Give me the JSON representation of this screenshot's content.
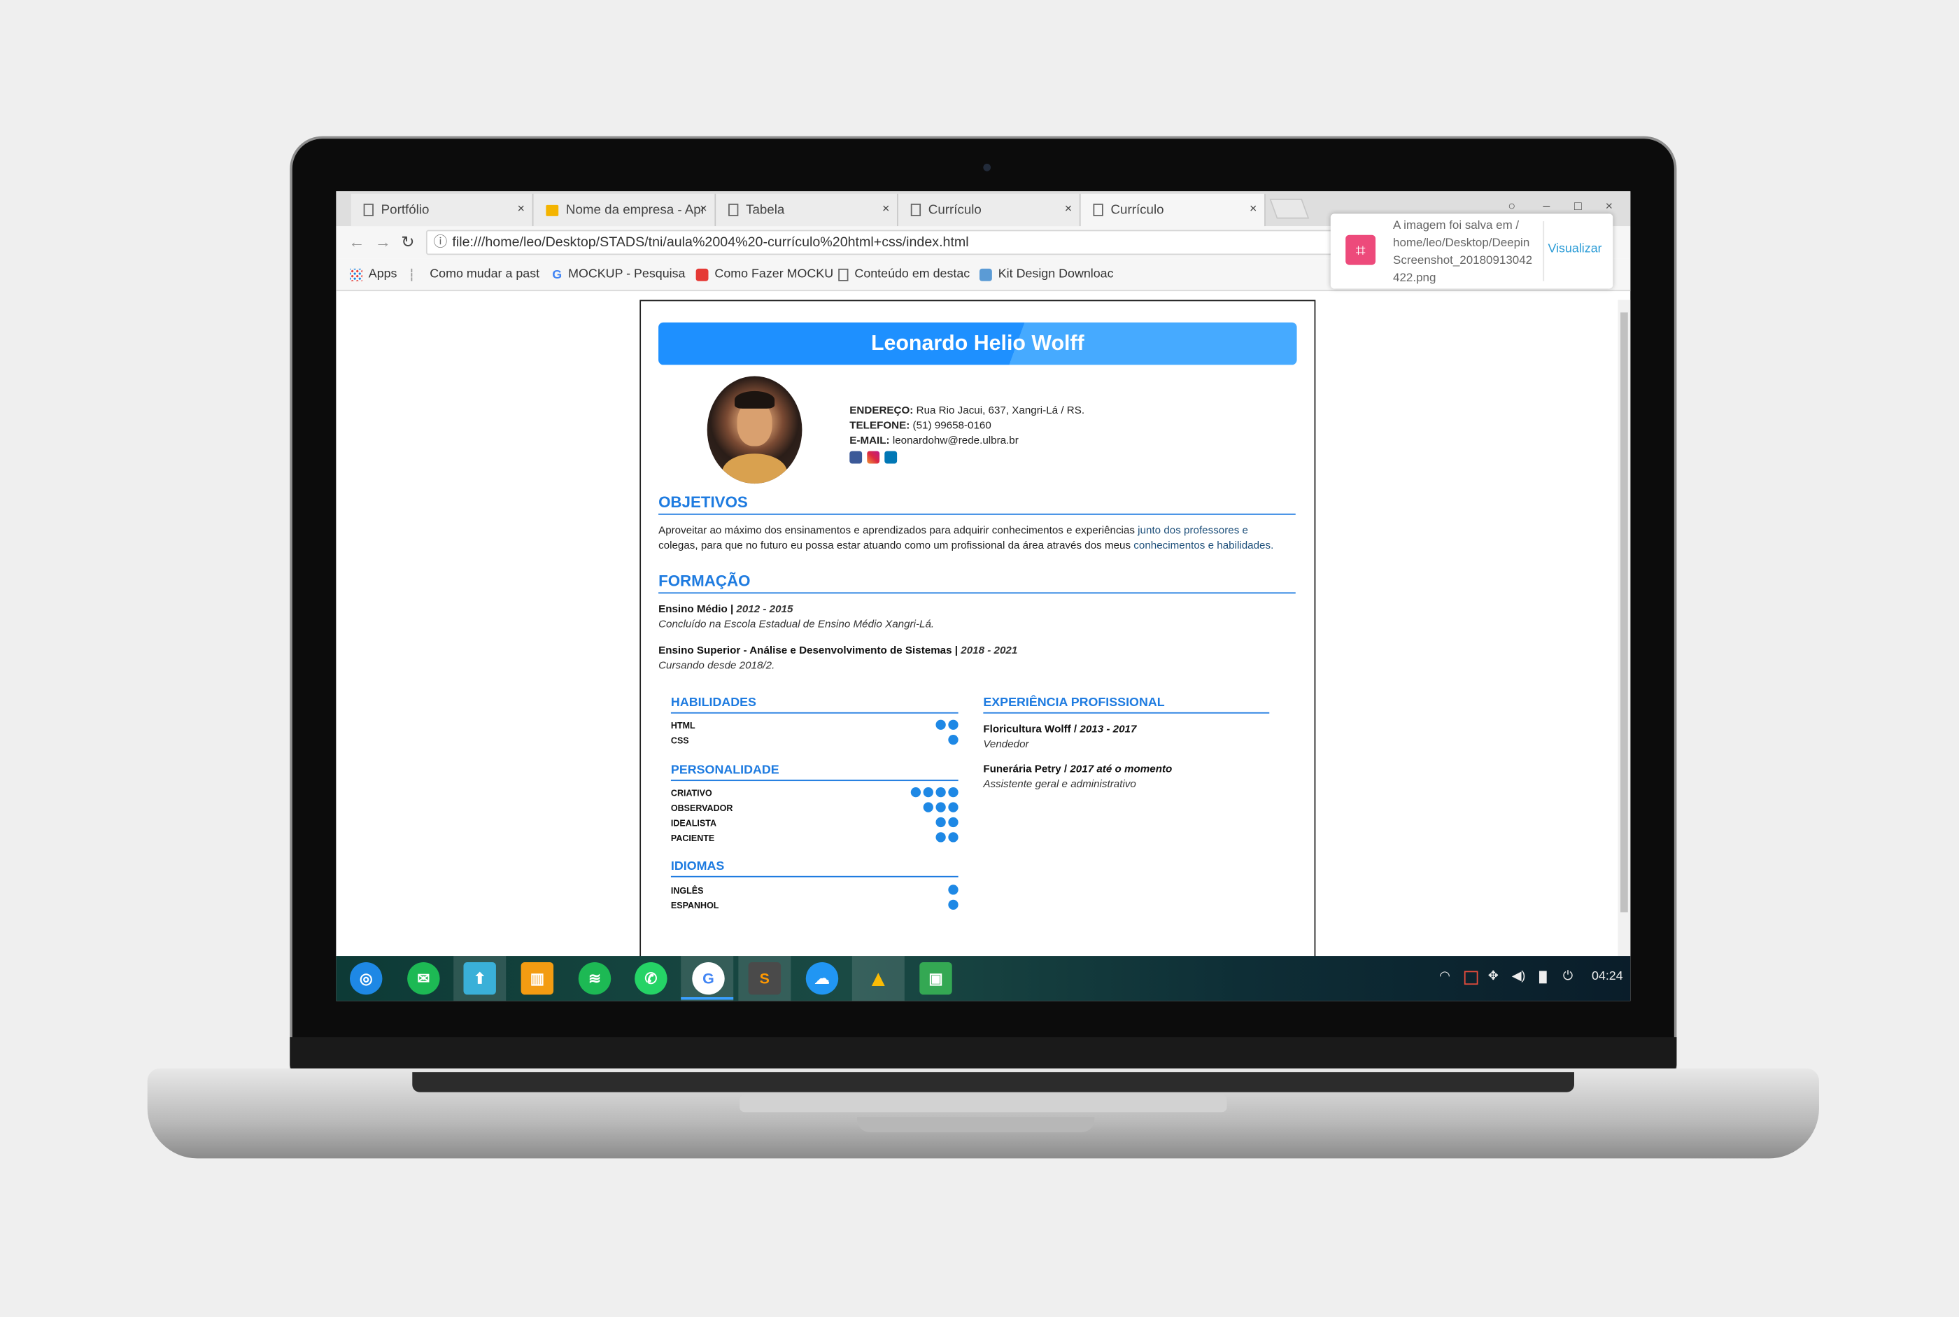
{
  "browser": {
    "tabs": [
      {
        "label": "Portfólio",
        "close": "×"
      },
      {
        "label": "Nome da empresa - Apr",
        "close": "×"
      },
      {
        "label": "Tabela",
        "close": "×"
      },
      {
        "label": "Currículo",
        "close": "×"
      },
      {
        "label": "Currículo",
        "close": "×"
      }
    ],
    "window_controls": {
      "minimize": "–",
      "maximize": "□",
      "close": "×"
    },
    "url": "file:///home/leo/Desktop/STADS/tni/aula%2004%20-currículo%20html+css/index.html",
    "bookmarks": [
      {
        "label": "Apps"
      },
      {
        "label": "Como mudar a past"
      },
      {
        "label": "MOCKUP - Pesquisa"
      },
      {
        "label": "Como Fazer MOCKU"
      },
      {
        "label": "Conteúdo em destac"
      },
      {
        "label": "Kit Design Downloac"
      }
    ]
  },
  "notification": {
    "text": "A imagem foi salva em / home/leo/Desktop/Deepin Screenshot_20180913042 422.png",
    "action": "Visualizar"
  },
  "resume": {
    "name": "Leonardo Helio Wolff",
    "contact": {
      "address_label": "ENDEREÇO:",
      "address": "Rua Rio Jacui, 637, Xangri-Lá / RS.",
      "phone_label": "TELEFONE:",
      "phone": "(51) 99658-0160",
      "email_label": "E-MAIL:",
      "email": "leonardohw@rede.ulbra.br"
    },
    "objectives": {
      "title": "OBJETIVOS",
      "line1_a": "Aproveitar ao máximo dos ensinamentos e aprendizados para adquirir conhecimentos e experiências ",
      "line1_b": "junto dos professores e",
      "line2_a": "colegas, para que no futuro eu possa estar atuando como um profissional da área através dos meus ",
      "line2_b": "conhecimentos e habilidades."
    },
    "education": {
      "title": "FORMAÇÃO",
      "items": [
        {
          "course": "Ensino Médio | ",
          "years": "2012 - 2015",
          "detail": "Concluído na Escola Estadual de Ensino Médio Xangri-Lá."
        },
        {
          "course": "Ensino Superior - Análise e Desenvolvimento de Sistemas | ",
          "years": "2018 - 2021",
          "detail": "Cursando desde 2018/2."
        }
      ]
    },
    "skills": {
      "title": "HABILIDADES",
      "items": [
        {
          "name": "HTML",
          "level": 2
        },
        {
          "name": "CSS",
          "level": 1
        }
      ]
    },
    "personality": {
      "title": "PERSONALIDADE",
      "items": [
        {
          "name": "CRIATIVO",
          "level": 4
        },
        {
          "name": "OBSERVADOR",
          "level": 3
        },
        {
          "name": "IDEALISTA",
          "level": 2
        },
        {
          "name": "PACIENTE",
          "level": 2
        }
      ]
    },
    "languages": {
      "title": "IDIOMAS",
      "items": [
        {
          "name": "INGLÊS",
          "level": 1
        },
        {
          "name": "ESPANHOL",
          "level": 1
        }
      ]
    },
    "experience": {
      "title": "EXPERIÊNCIA PROFISSIONAL",
      "items": [
        {
          "company": "Floricultura Wolff / ",
          "period": "2013 - 2017",
          "role": "Vendedor"
        },
        {
          "company": "Funerária Petry / ",
          "period": "2017 até o momento",
          "role": "Assistente geral e administrativo"
        }
      ]
    }
  },
  "taskbar": {
    "clock": "04:24"
  },
  "colors": {
    "accent": "#1e7be0",
    "name_bar": "#1e90ff",
    "dot": "#1e88e5"
  }
}
